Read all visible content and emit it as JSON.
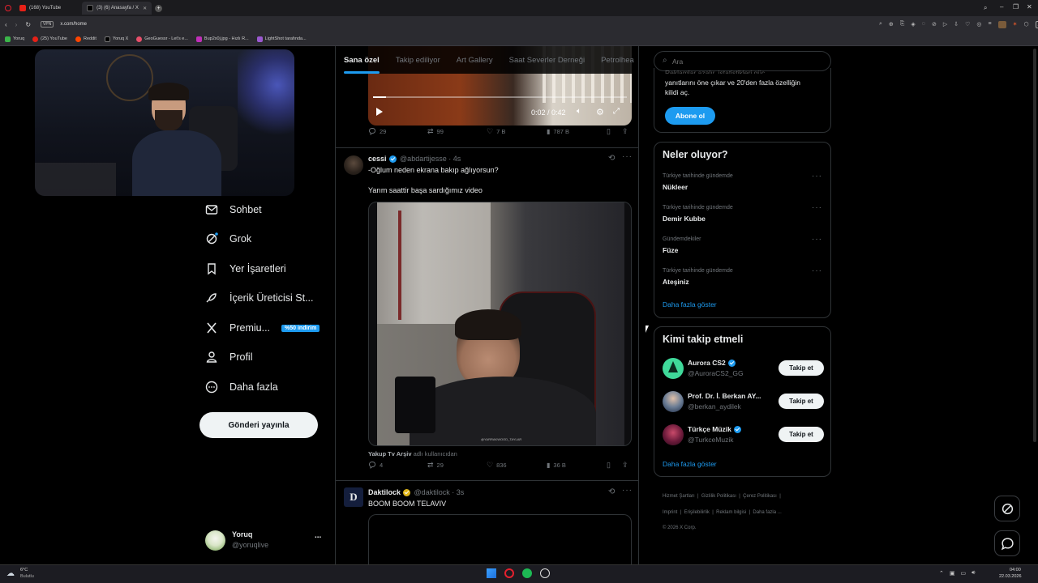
{
  "browser": {
    "tabs": [
      {
        "label": "(168) YouTube"
      },
      {
        "label": "(3) (6) Anasayfa / X"
      }
    ],
    "vpn_label": "VPN",
    "url": "x.com/home",
    "bookmarks": [
      {
        "label": "Yoruq"
      },
      {
        "label": "(25) YouTube"
      },
      {
        "label": "Reddit"
      },
      {
        "label": "Yoruq X"
      },
      {
        "label": "GeoGuessr - Let's e..."
      },
      {
        "label": "Bup2x0j.jpg - Hızlı R..."
      },
      {
        "label": "LightShot tarafında..."
      }
    ],
    "ai_label": "AI"
  },
  "nav": {
    "items": [
      {
        "label": "Sohbet"
      },
      {
        "label": "Grok"
      },
      {
        "label": "Yer İşaretleri"
      },
      {
        "label": "İçerik Üreticisi St..."
      },
      {
        "label": "Premiu...",
        "badge": "%50 indirim"
      },
      {
        "label": "Profil"
      },
      {
        "label": "Daha fazla"
      }
    ],
    "post_button": "Gönderi yayınla",
    "account": {
      "name": "Yoruq",
      "handle": "@yoruqlive",
      "more": "..."
    }
  },
  "timeline": {
    "tabs": [
      "Sana özel",
      "Takip ediliyor",
      "Art Gallery",
      "Saat Severler Derneği",
      "Petrolhea"
    ],
    "video": {
      "time": "0:02 / 0:42"
    },
    "post1_stats": {
      "replies": "29",
      "reposts": "99",
      "likes": "7 B",
      "views": "787 B"
    },
    "post2": {
      "name": "cessi",
      "handle": "@abdartijesse",
      "age": "4s",
      "line1": "-Oğlum neden ekrana bakıp ağlıyorsun?",
      "line2": "Yarım saattir başa sardığımız video",
      "watermark": "@YARRAKWOOD_TAYLAR",
      "attribution_name": "Yakup Tv Arşiv",
      "attribution_suffix": "adlı kullanıcıdan",
      "stats": {
        "replies": "4",
        "reposts": "29",
        "likes": "836",
        "views": "36 B"
      }
    },
    "post3": {
      "name": "Daktilock",
      "handle": "@daktilock",
      "age": "3s",
      "text": "BOOM BOOM TELAVIV",
      "avatar_letter": "D"
    }
  },
  "right": {
    "search_placeholder": "Ara",
    "premium": {
      "text_partial": "Reklamlar azalır, istatistikleri güç,",
      "text_line2": "yanıtlarını öne çıkar ve 20'den fazla özelliğin",
      "text_line3": "kilidi aç.",
      "button": "Abone ol"
    },
    "trends": {
      "title": "Neler oluyor?",
      "items": [
        {
          "meta": "Türkiye tarihinde gündemde",
          "name": "Nükleer"
        },
        {
          "meta": "Türkiye tarihinde gündemde",
          "name": "Demir Kubbe"
        },
        {
          "meta": "Gündemdekiler",
          "name": "Füze"
        },
        {
          "meta": "Türkiye tarihinde gündemde",
          "name": "Ateşiniz"
        }
      ],
      "more": "Daha fazla göster"
    },
    "who_to_follow": {
      "title": "Kimi takip etmeli",
      "items": [
        {
          "name": "Aurora CS2",
          "handle": "@AuroraCS2_GG",
          "button": "Takip et"
        },
        {
          "name": "Prof. Dr. İ. Berkan AY...",
          "handle": "@berkan_aydilek",
          "button": "Takip et"
        },
        {
          "name": "Türkçe Müzik",
          "handle": "@TurkceMuzik",
          "button": "Takip et"
        }
      ],
      "more": "Daha fazla göster"
    },
    "footer": {
      "links": [
        "Hizmet Şartları",
        "Gizlilik Politikası",
        "Çerez Politikası",
        "Imprint",
        "Erişilebilirlik",
        "Reklam bilgisi",
        "Daha fazla ..."
      ],
      "copyright": "© 2026 X Corp."
    }
  },
  "taskbar": {
    "weather_temp": "6°C",
    "weather_desc": "Bulutlu",
    "time": "04:00",
    "date": "22.03.2026"
  }
}
